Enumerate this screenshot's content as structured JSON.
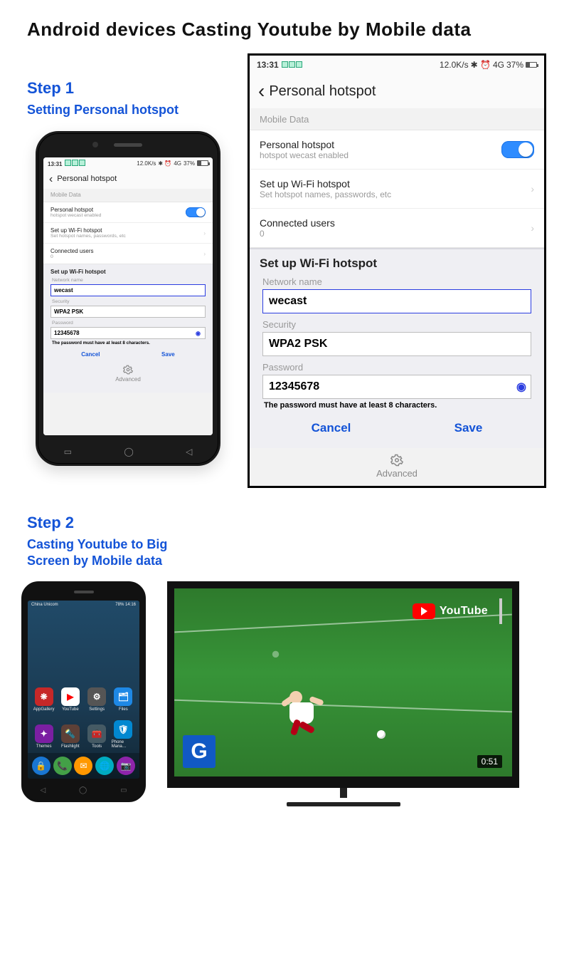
{
  "title": "Android devices Casting Youtube by Mobile data",
  "step1": {
    "label": "Step 1",
    "sub": "Setting Personal hotspot"
  },
  "step2": {
    "label": "Step 2",
    "sub": "Casting Youtube to Big Screen by Mobile data"
  },
  "status": {
    "time": "13:31",
    "rate": "12.0K/s",
    "net": "4G",
    "battery_pct": "37%"
  },
  "settings": {
    "header": "Personal hotspot",
    "section_label": "Mobile Data",
    "item_hotspot": {
      "title": "Personal hotspot",
      "sub": "hotspot wecast enabled",
      "on": true
    },
    "item_setup": {
      "title": "Set up Wi-Fi hotspot",
      "sub": "Set hotspot names, passwords, etc"
    },
    "item_users": {
      "title": "Connected users",
      "sub": "0"
    },
    "form": {
      "title": "Set up Wi-Fi hotspot",
      "name_label": "Network name",
      "name_value": "wecast",
      "sec_label": "Security",
      "sec_value": "WPA2 PSK",
      "pw_label": "Password",
      "pw_value": "12345678",
      "hint": "The password must have at least 8 characters.",
      "cancel": "Cancel",
      "save": "Save",
      "advanced": "Advanced"
    }
  },
  "home": {
    "carrier": "China Unicom",
    "right": "78%  14:16",
    "apps": [
      {
        "label": "AppGallery",
        "bg": "#c62828",
        "glyph": "❋"
      },
      {
        "label": "YouTube",
        "bg": "#ffffff",
        "glyph": "▶",
        "fg": "#ff0000"
      },
      {
        "label": "Settings",
        "bg": "#555",
        "glyph": "⚙"
      },
      {
        "label": "Files",
        "bg": "#1e88e5",
        "glyph": "🗂"
      },
      {
        "label": "Themes",
        "bg": "#7b1fa2",
        "glyph": "✦"
      },
      {
        "label": "Flashlight",
        "bg": "#5d4037",
        "glyph": "🔦"
      },
      {
        "label": "Tools",
        "bg": "#455a64",
        "glyph": "🧰"
      },
      {
        "label": "Phone Mana…",
        "bg": "#0288d1",
        "glyph": "🛡"
      }
    ],
    "dock": [
      {
        "bg": "#1976d2",
        "glyph": "🔒"
      },
      {
        "bg": "#43a047",
        "glyph": "📞"
      },
      {
        "bg": "#ff9800",
        "glyph": "✉"
      },
      {
        "bg": "#00acc1",
        "glyph": "🌐"
      },
      {
        "bg": "#8e24aa",
        "glyph": "📷"
      }
    ]
  },
  "tv": {
    "logo_text": "YouTube",
    "channel_badge": "G",
    "elapsed": "0:51"
  }
}
